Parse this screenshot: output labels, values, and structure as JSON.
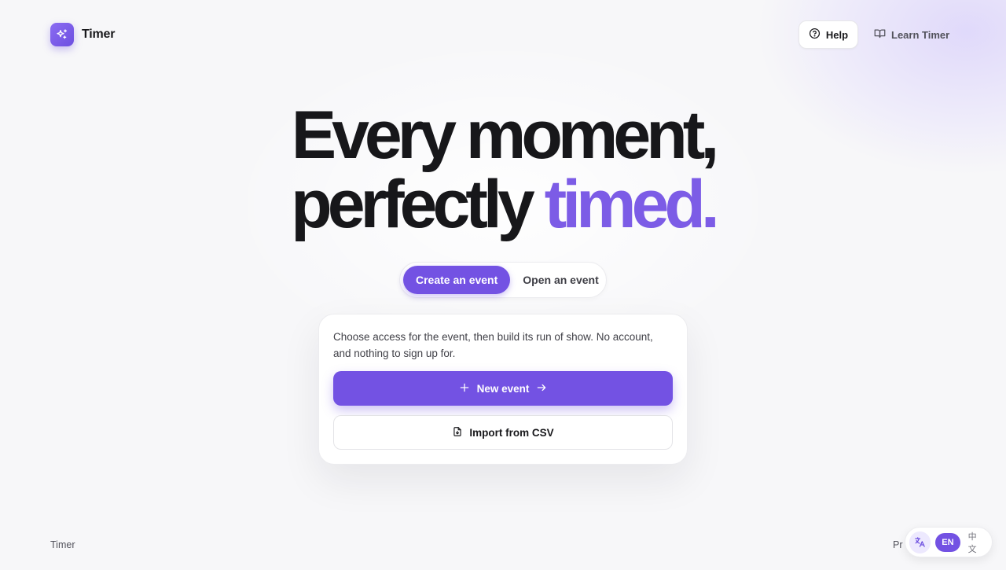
{
  "header": {
    "app_name": "Timer",
    "help_label": "Help",
    "learn_label": "Learn Timer"
  },
  "hero": {
    "line1": "Every moment,",
    "line2_plain": "perfectly ",
    "line2_accent": "timed."
  },
  "tabs": [
    {
      "label": "Create an event",
      "active": true
    },
    {
      "label": "Open an event",
      "active": false
    }
  ],
  "card": {
    "description": "Choose access for the event, then build its run of show. No account, and nothing to sign up for.",
    "primary_label": "New event",
    "secondary_label": "Import from CSV"
  },
  "footer": {
    "brand": "Timer",
    "link_partial": "Pr"
  },
  "language": {
    "current": "EN",
    "other": "中文"
  },
  "colors": {
    "accent": "#7352e3",
    "accent_text": "#7c5ce6",
    "text": "#18181b"
  }
}
